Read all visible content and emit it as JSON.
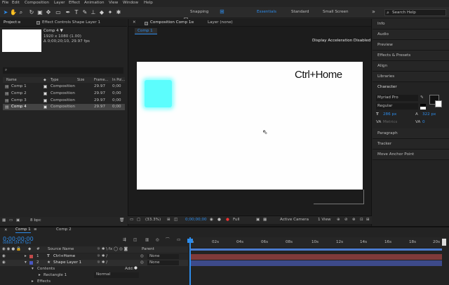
{
  "menu": [
    "File",
    "Edit",
    "Composition",
    "Layer",
    "Effect",
    "Animation",
    "View",
    "Window",
    "Help"
  ],
  "toolbar": {
    "snapping": "Snapping",
    "workspaces": [
      "Essentials",
      "Standard",
      "Small Screen"
    ],
    "search_placeholder": "Search Help"
  },
  "project": {
    "tab_project": "Project",
    "tab_effect_controls": "Effect Controls Shape Layer 1",
    "selected_name": "Comp 4 ▼",
    "selected_size": "1920 x 1080 (1.00)",
    "selected_duration": "Δ 0;00;20;10, 29.97 fps",
    "search_placeholder": "",
    "columns": [
      "Name",
      "Type",
      "Size",
      "Frame...",
      "In Poi..."
    ],
    "items": [
      {
        "name": "Comp 1",
        "type": "Composition",
        "fps": "29.97",
        "in": "0;00"
      },
      {
        "name": "Comp 2",
        "type": "Composition",
        "fps": "29.97",
        "in": "0;00"
      },
      {
        "name": "Comp 3",
        "type": "Composition",
        "fps": "29.97",
        "in": "0;00"
      },
      {
        "name": "Comp 4",
        "type": "Composition",
        "fps": "29.97",
        "in": "0;00"
      }
    ],
    "bpc": "8 bpc"
  },
  "viewer": {
    "tab_composition": "Composition Comp 1",
    "tab_layer": "Layer (none)",
    "comp_chip": "Comp 1",
    "accel_text": "Display Acceleration Disabled",
    "canvas_text": "Ctrl+Home",
    "zoom": "(33.3%)",
    "timecode": "0;00;00;00",
    "resolution": "Full",
    "camera": "Active Camera",
    "views": "1 View"
  },
  "right_panels": [
    "Info",
    "Audio",
    "Preview",
    "Effects & Presets",
    "Align",
    "Libraries",
    "Character",
    "Paragraph",
    "Tracker",
    "Move Anchor Point"
  ],
  "character": {
    "font": "Myriad Pro",
    "style": "Regular",
    "size": "286 px",
    "leading": "322 px",
    "tracking_label": "Metrics",
    "kerning": "0",
    "unit": "px",
    "stroke": "—"
  },
  "timeline": {
    "tab_comp1": "Comp 1",
    "tab_comp2": "Comp 2",
    "timecode": "0;00;00;00",
    "timecode_sub": "00000 (29.97 fps)",
    "col_source": "Source Name",
    "col_parent": "Parent",
    "rulers": [
      "0s",
      "02s",
      "04s",
      "06s",
      "08s",
      "10s",
      "12s",
      "14s",
      "16s",
      "18s",
      "20s"
    ],
    "layers": [
      {
        "num": "1",
        "name": "Ctrl+Home",
        "parent": "None",
        "color": "#c24a4a"
      },
      {
        "num": "2",
        "name": "Shape Layer 1",
        "parent": "None",
        "color": "#4a57c2"
      }
    ],
    "contents_label": "Contents",
    "add_label": "Add:",
    "rect_label": "Rectangle 1",
    "normal": "Normal",
    "effects_label": "Effects"
  },
  "colors": {
    "accent": "#2d8ceb",
    "square": "#5cfdfd"
  }
}
